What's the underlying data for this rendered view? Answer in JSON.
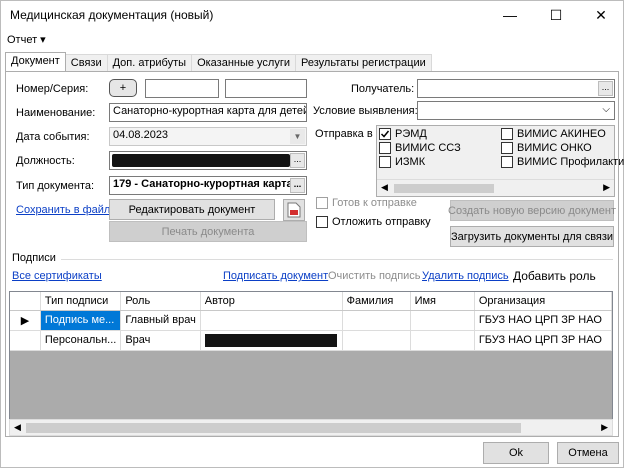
{
  "window": {
    "title": "Медицинская документация (новый)",
    "minimize_glyph": "—",
    "maximize_glyph": "☐",
    "close_glyph": "✕"
  },
  "menu": {
    "report_label": "Отчет ▾"
  },
  "tabs": [
    {
      "label": "Документ",
      "active": true
    },
    {
      "label": "Связи"
    },
    {
      "label": "Доп. атрибуты"
    },
    {
      "label": "Оказанные услуги"
    },
    {
      "label": "Результаты регистрации"
    }
  ],
  "form": {
    "number_label": "Номер/Серия:",
    "plus_label": "+",
    "name_label": "Наименование:",
    "name_value": "Санаторно-курортная карта для детей (CDA)",
    "event_date_label": "Дата события:",
    "event_date_value": "04.08.2023",
    "position_label": "Должность:",
    "doc_type_label": "Тип документа:",
    "doc_type_value": "179 - Санаторно-курортная карта ...",
    "save_to_file_link": "Сохранить в файл",
    "edit_doc_button": "Редактировать документ",
    "print_doc_button": "Печать документа",
    "recipient_label": "Получатель:",
    "condition_label": "Условие выявления:",
    "send_to_label": "Отправка в",
    "send_targets": [
      {
        "label": "РЭМД",
        "checked": true
      },
      {
        "label": "ВИМИС АКИНЕО",
        "checked": false
      },
      {
        "label": "ВИМИС ССЗ",
        "checked": false
      },
      {
        "label": "ВИМИС ОНКО",
        "checked": false
      },
      {
        "label": "ИЗМК",
        "checked": false
      },
      {
        "label": "ВИМИС Профилактик...",
        "checked": false
      }
    ],
    "ready_to_send_label": "Готов к отправке",
    "postpone_label": "Отложить отправку",
    "new_version_button": "Создать новую версию документ",
    "load_for_link_button": "Загрузить документы для связи"
  },
  "signatures": {
    "section_label": "Подписи",
    "all_certs_link": "Все сертификаты",
    "sign_doc_link": "Подписать документ",
    "clear_sign_link": "Очистить подпись",
    "delete_sign_link": "Удалить подпись",
    "add_role_button": "Добавить роль",
    "columns": [
      "Тип подписи",
      "Роль",
      "Автор",
      "Фамилия",
      "Имя",
      "Организация"
    ],
    "rows": [
      {
        "indicator": "▶",
        "type": "Подпись ме...",
        "role": "Главный врач",
        "author": "",
        "surname": "",
        "name": "",
        "org": "ГБУЗ НАО ЦРП ЗР НАО"
      },
      {
        "indicator": "",
        "type": "Персональн...",
        "role": "Врач",
        "author": "",
        "surname": "",
        "name": "",
        "org": "ГБУЗ НАО ЦРП ЗР НАО"
      }
    ]
  },
  "footer": {
    "ok_button": "Ok",
    "cancel_button": "Отмена"
  }
}
